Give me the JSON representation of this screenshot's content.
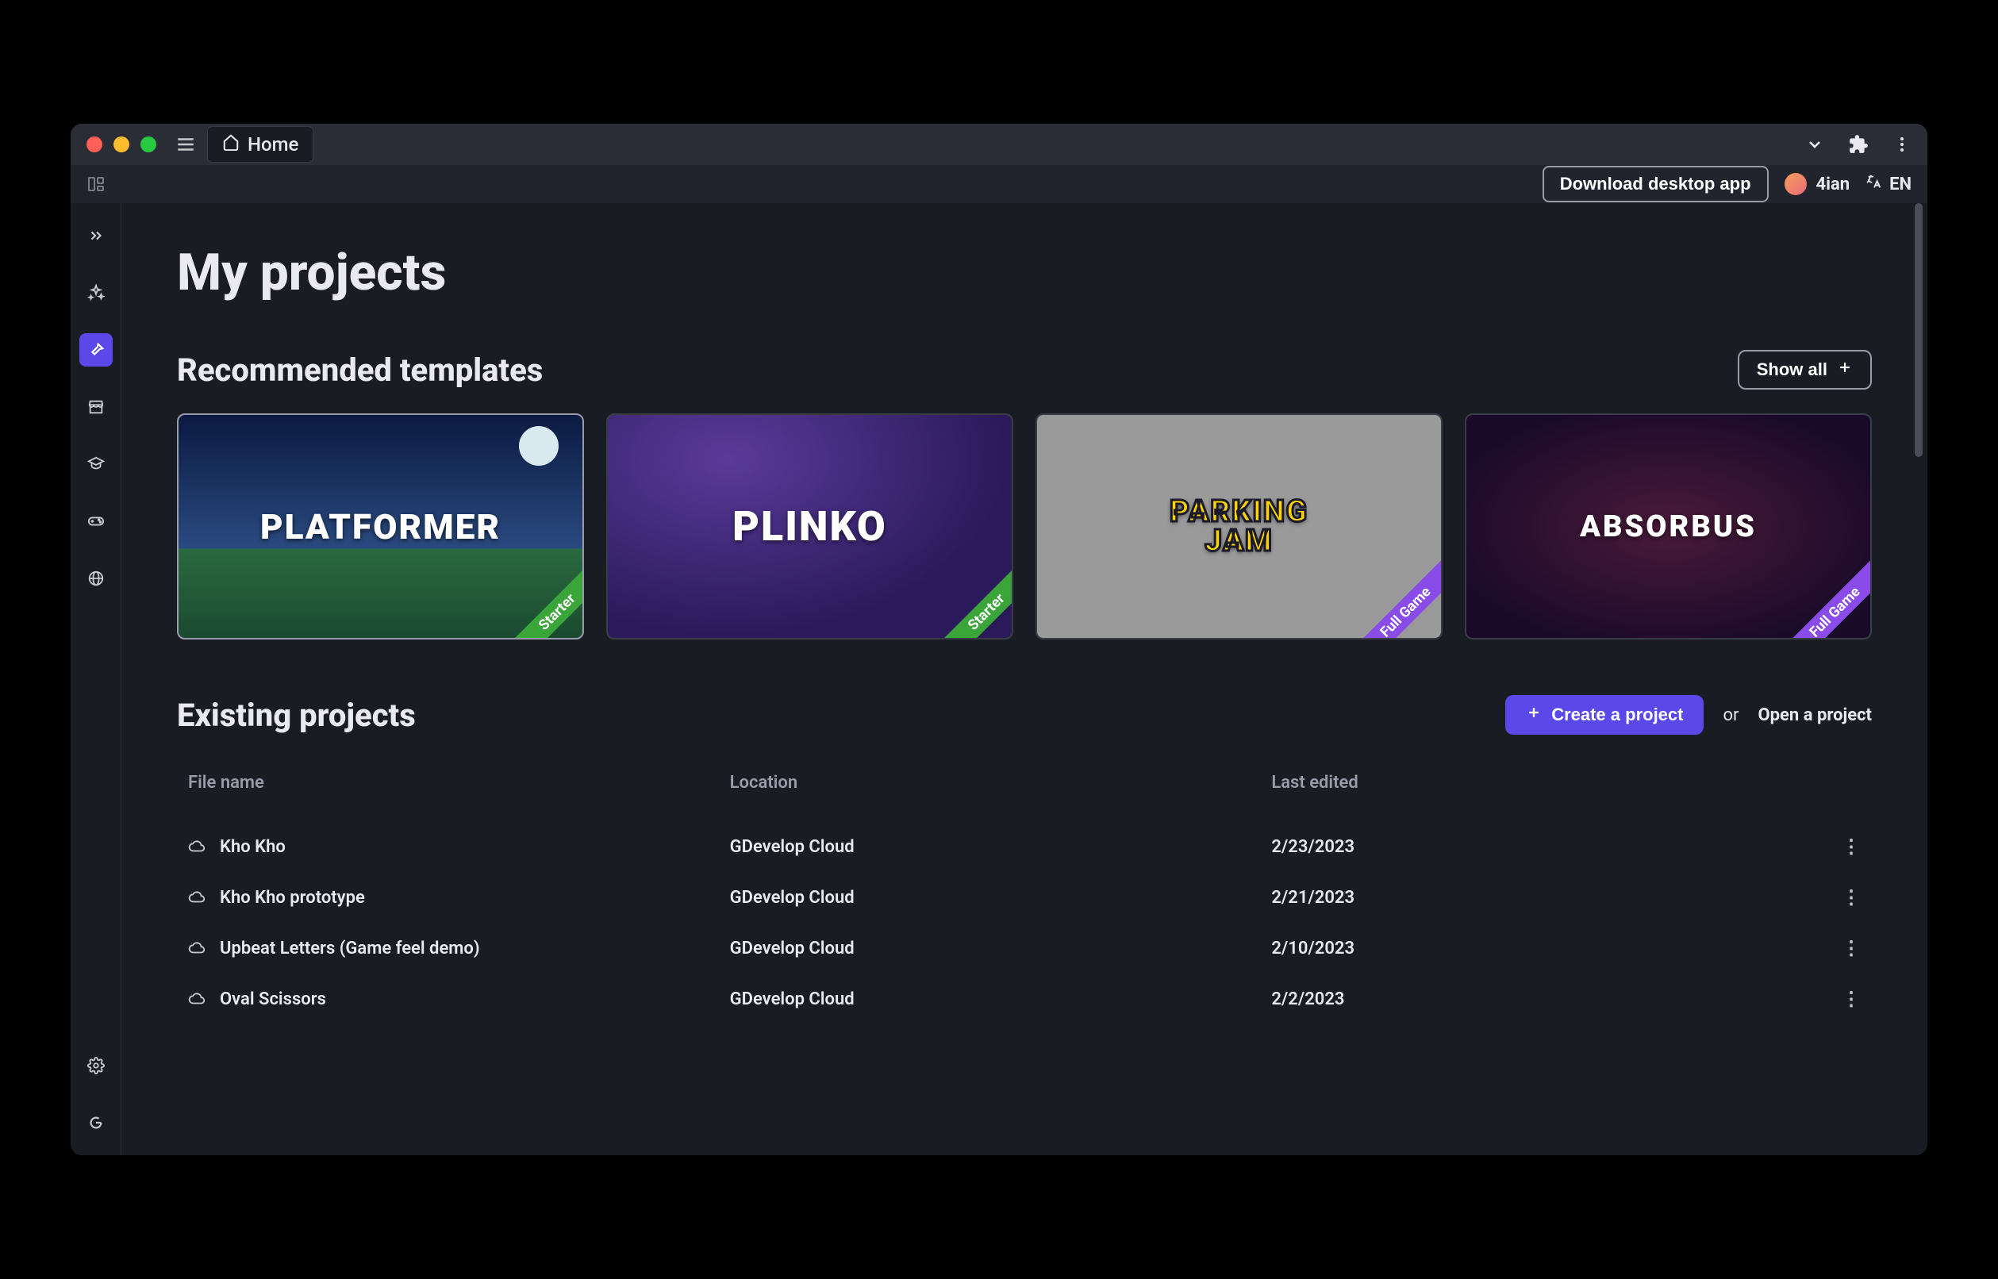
{
  "titlebar": {
    "tab_label": "Home"
  },
  "subheader": {
    "download_label": "Download desktop app",
    "username": "4ian",
    "language": "EN"
  },
  "sidebar": {
    "items": [
      {
        "name": "expand",
        "icon": "chevrons"
      },
      {
        "name": "discover",
        "icon": "sparkle"
      },
      {
        "name": "build",
        "icon": "pick",
        "active": true
      },
      {
        "name": "store",
        "icon": "store"
      },
      {
        "name": "learn",
        "icon": "graduation"
      },
      {
        "name": "play",
        "icon": "gamepad"
      },
      {
        "name": "web",
        "icon": "globe"
      }
    ],
    "bottom_items": [
      {
        "name": "settings",
        "icon": "gear"
      },
      {
        "name": "gd-logo",
        "icon": "gd"
      }
    ]
  },
  "page": {
    "title": "My projects",
    "recommended": {
      "heading": "Recommended templates",
      "show_all_label": "Show all"
    },
    "existing": {
      "heading": "Existing projects",
      "create_label": "Create a project",
      "or_label": "or",
      "open_label": "Open a project"
    }
  },
  "templates": [
    {
      "title": "PLATFORMER",
      "ribbon": "Starter",
      "ribbon_type": "starter",
      "theme": "tpl-platformer"
    },
    {
      "title": "PLINKO",
      "ribbon": "Starter",
      "ribbon_type": "starter",
      "theme": "tpl-plinko"
    },
    {
      "title": "PARKING\nJAM",
      "ribbon": "Full Game",
      "ribbon_type": "fullgame",
      "theme": "tpl-parking"
    },
    {
      "title": "ABSORBUS",
      "ribbon": "Full Game",
      "ribbon_type": "fullgame",
      "theme": "tpl-absorbus"
    }
  ],
  "projects_table": {
    "columns": [
      "File name",
      "Location",
      "Last edited"
    ],
    "rows": [
      {
        "name": "Kho Kho",
        "location": "GDevelop Cloud",
        "edited": "2/23/2023"
      },
      {
        "name": "Kho Kho prototype",
        "location": "GDevelop Cloud",
        "edited": "2/21/2023"
      },
      {
        "name": "Upbeat Letters (Game feel demo)",
        "location": "GDevelop Cloud",
        "edited": "2/10/2023"
      },
      {
        "name": "Oval Scissors",
        "location": "GDevelop Cloud",
        "edited": "2/2/2023"
      }
    ]
  }
}
